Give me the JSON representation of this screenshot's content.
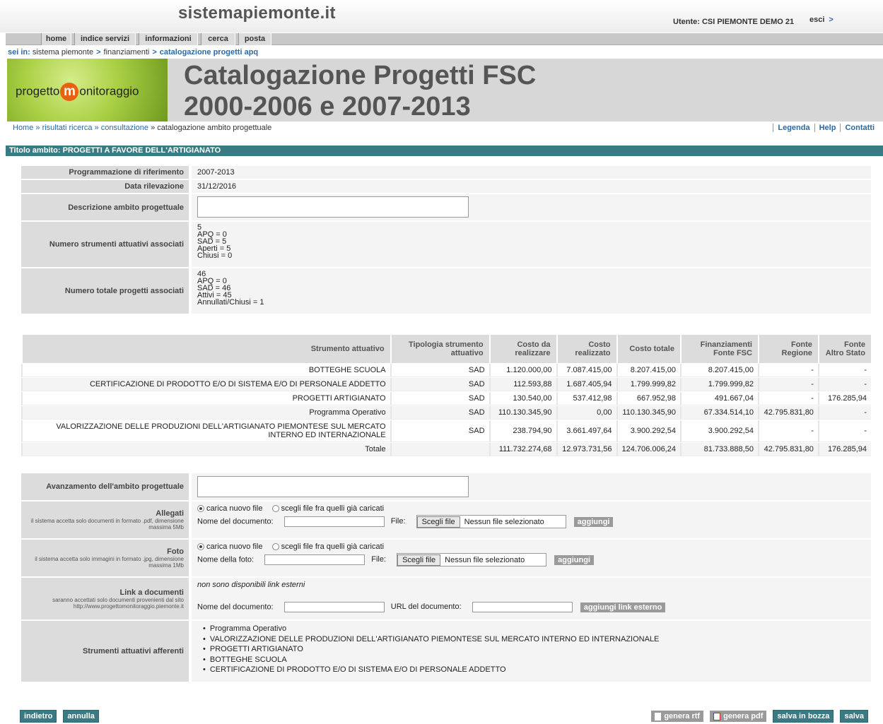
{
  "header": {
    "site_title": "sistemapiemonte.it",
    "user": "Utente: CSI PIEMONTE DEMO 21",
    "logout": "esci",
    "logout_arrow": ">"
  },
  "nav": [
    "home",
    "indice servizi",
    "informazioni",
    "cerca",
    "posta"
  ],
  "breadcrumb": {
    "label": "sei in:",
    "items": [
      "sistema piemonte",
      "finanziamenti"
    ],
    "current": "catalogazione progetti apq",
    "sep": ">"
  },
  "banner": {
    "logo_text_left": "progetto",
    "logo_m": "m",
    "logo_text_right": "onitoraggio",
    "title_line1": "Catalogazione Progetti FSC",
    "title_line2": "2000-2006 e 2007-2013"
  },
  "path": {
    "items": [
      "Home",
      "» risultati ricerca",
      "» consultazione"
    ],
    "current": "» catalogazione ambito progettuale"
  },
  "right_links": [
    "Legenda",
    "Help",
    "Contatti"
  ],
  "section_title": "Titolo ambito: PROGETTI A FAVORE DELL'ARTIGIANATO",
  "details": {
    "prog_label": "Programmazione di riferimento",
    "prog_value": "2007-2013",
    "data_label": "Data rilevazione",
    "data_value": "31/12/2016",
    "descr_label": "Descrizione ambito progettuale",
    "strumenti_label": "Numero strumenti attuativi associati",
    "strumenti_lines": [
      "5",
      "APQ = 0",
      "SAD = 5",
      "Aperti = 5",
      "Chiusi = 0"
    ],
    "progetti_label": "Numero totale progetti associati",
    "progetti_lines": [
      "46",
      "APQ = 0",
      "SAD = 46",
      "Attivi = 45",
      "Annullati/Chiusi = 1"
    ]
  },
  "table": {
    "headers": [
      "Strumento attuativo",
      "Tipologia strumento attuativo",
      "Costo da realizzare",
      "Costo realizzato",
      "Costo totale",
      "Finanziamenti Fonte FSC",
      "Fonte Regione",
      "Fonte Altro Stato"
    ],
    "rows": [
      [
        "BOTTEGHE SCUOLA",
        "SAD",
        "1.120.000,00",
        "7.087.415,00",
        "8.207.415,00",
        "8.207.415,00",
        "-",
        "-"
      ],
      [
        "CERTIFICAZIONE DI PRODOTTO E/O DI SISTEMA E/O DI PERSONALE ADDETTO",
        "SAD",
        "112.593,88",
        "1.687.405,94",
        "1.799.999,82",
        "1.799.999,82",
        "-",
        "-"
      ],
      [
        "PROGETTI ARTIGIANATO",
        "SAD",
        "130.540,00",
        "537.412,98",
        "667.952,98",
        "491.667,04",
        "-",
        "176.285,94"
      ],
      [
        "Programma Operativo",
        "SAD",
        "110.130.345,90",
        "0,00",
        "110.130.345,90",
        "67.334.514,10",
        "42.795.831,80",
        "-"
      ],
      [
        "VALORIZZAZIONE DELLE PRODUZIONI DELL'ARTIGIANATO PIEMONTESE SUL MERCATO INTERNO ED INTERNAZIONALE",
        "SAD",
        "238.794,90",
        "3.661.497,64",
        "3.900.292,54",
        "3.900.292,54",
        "-",
        "-"
      ],
      [
        "Totale",
        "",
        "111.732.274,68",
        "12.973.731,56",
        "124.706.006,24",
        "81.733.888,50",
        "42.795.831,80",
        "176.285,94"
      ]
    ]
  },
  "form": {
    "avanz_label": "Avanzamento dell'ambito progettuale",
    "allegati_label": "Allegati",
    "allegati_hint": "il sistema accetta solo documenti in formato .pdf, dimensione massima 5Mb",
    "foto_label": "Foto",
    "foto_hint": "il sistema accetta solo immagini in formato .jpg, dimensione massima 1Mb",
    "radio_new": "carica nuovo file",
    "radio_existing": "scegli file fra quelli già caricati",
    "nome_doc": "Nome del documento:",
    "nome_foto": "Nome della foto:",
    "file": "File:",
    "choose_file": "Scegli file",
    "no_file": "Nessun file selezionato",
    "add": "aggiungi",
    "link_label": "Link a documenti",
    "link_hint": "saranno accettati solo documenti provenienti dal sito http://www.progettomonitoraggio.piemonte.it",
    "no_links": "non sono disponibili link esterni",
    "url_doc": "URL del documento:",
    "add_link": "aggiungi link esterno",
    "afferenti_label": "Strumenti attuativi afferenti",
    "afferenti": [
      "Programma Operativo",
      "VALORIZZAZIONE DELLE PRODUZIONI DELL'ARTIGIANATO PIEMONTESE SUL MERCATO INTERNO ED INTERNAZIONALE",
      "PROGETTI ARTIGIANATO",
      "BOTTEGHE SCUOLA",
      "CERTIFICAZIONE DI PRODOTTO E/O DI SISTEMA E/O DI PERSONALE ADDETTO"
    ]
  },
  "buttons": {
    "back": "indietro",
    "cancel": "annulla",
    "rtf": "genera rtf",
    "pdf": "genera pdf",
    "draft": "salva in bozza",
    "save": "salva"
  }
}
